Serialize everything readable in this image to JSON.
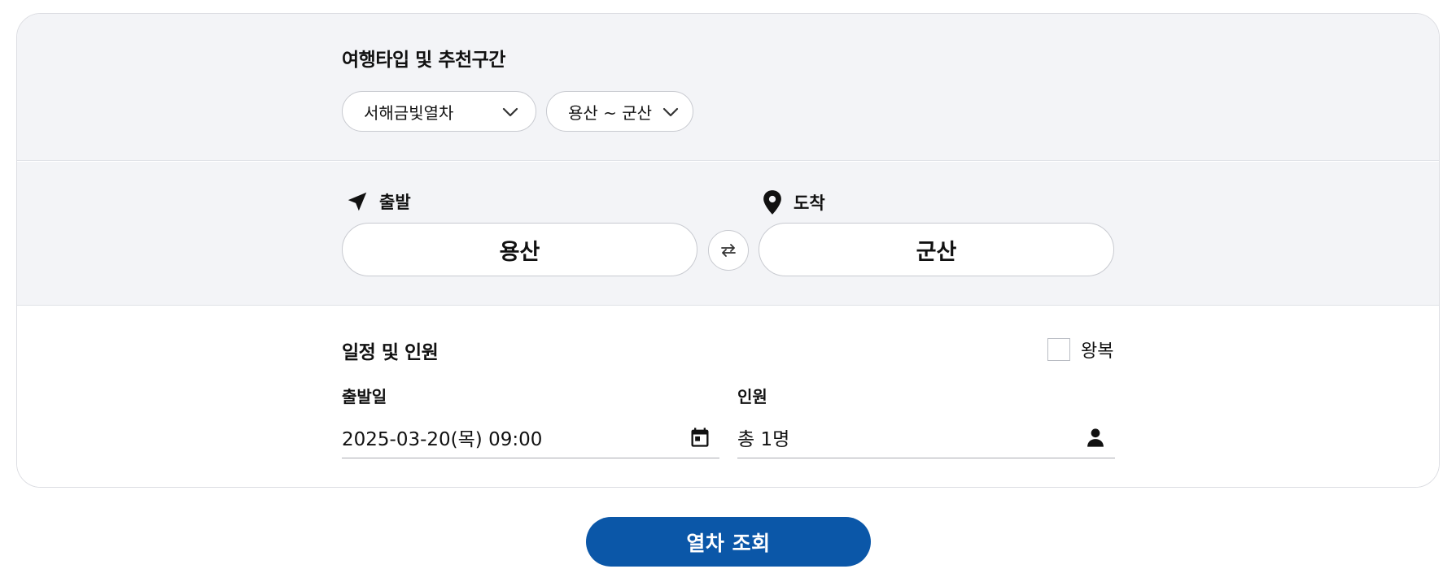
{
  "trip_type": {
    "title": "여행타입 및 추천구간",
    "train_select": "서해금빛열차",
    "route_select": "용산 ~ 군산"
  },
  "route": {
    "departure_label": "출발",
    "arrival_label": "도착",
    "departure_station": "용산",
    "arrival_station": "군산"
  },
  "schedule": {
    "title": "일정 및 인원",
    "round_trip_label": "왕복",
    "round_trip_checked": false,
    "date_label": "출발일",
    "date_value": "2025-03-20(목) 09:00",
    "passengers_label": "인원",
    "passengers_value": "총 1명"
  },
  "actions": {
    "search_label": "열차 조회"
  },
  "colors": {
    "accent": "#0b57a8",
    "section_bg": "#f3f4f7"
  }
}
